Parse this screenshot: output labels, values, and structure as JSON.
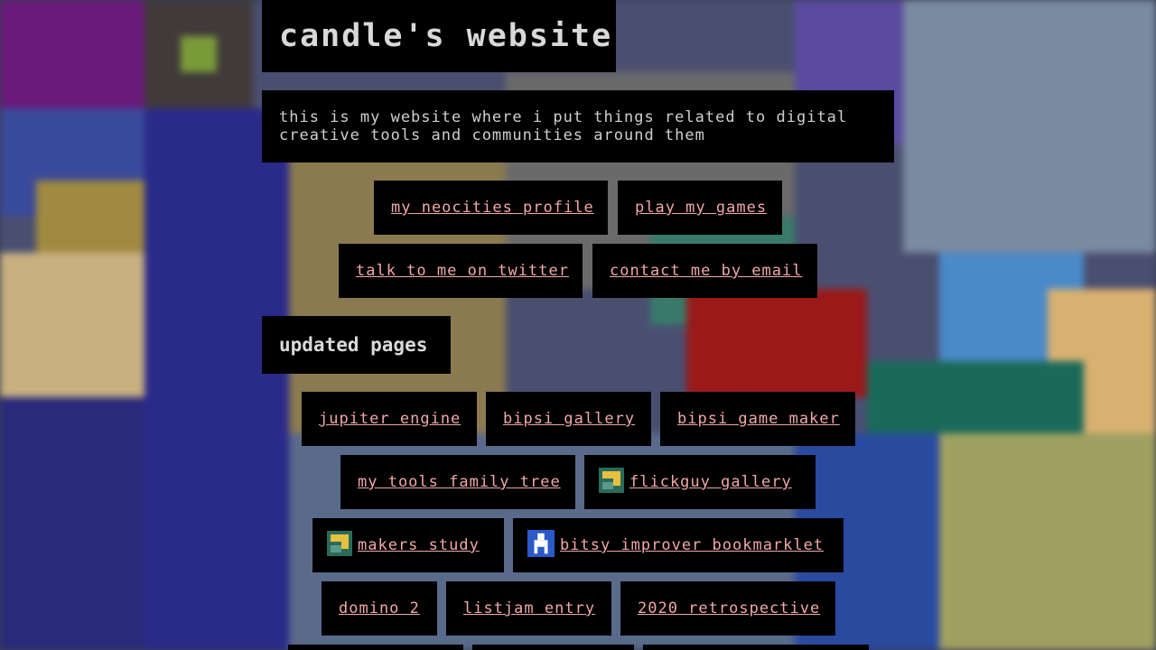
{
  "site_title": "candle's website",
  "intro": {
    "line1": "this is my website where i put things related to digital",
    "line2": "creative tools and communities around them"
  },
  "links": {
    "neocities": "my neocities profile",
    "games": "play my games",
    "twitter": "talk to me on twitter",
    "email": "contact me by email"
  },
  "updated_heading": "updated pages",
  "pages": [
    {
      "label": "jupiter engine"
    },
    {
      "label": "bipsi gallery"
    },
    {
      "label": "bipsi game maker"
    },
    {
      "label": "my tools family tree"
    },
    {
      "label": "flickguy gallery",
      "icon": "flickguy-icon"
    },
    {
      "label": "makers study",
      "icon": "flickguy-icon"
    },
    {
      "label": "bitsy improver bookmarklet",
      "icon": "bitsy-avatar-icon"
    },
    {
      "label": "domino 2"
    },
    {
      "label": "listjam entry"
    },
    {
      "label": "2020 retrospective"
    }
  ],
  "colors": {
    "background": "#000000",
    "text": "#d9d9d9",
    "link": "#f0a8a8"
  }
}
